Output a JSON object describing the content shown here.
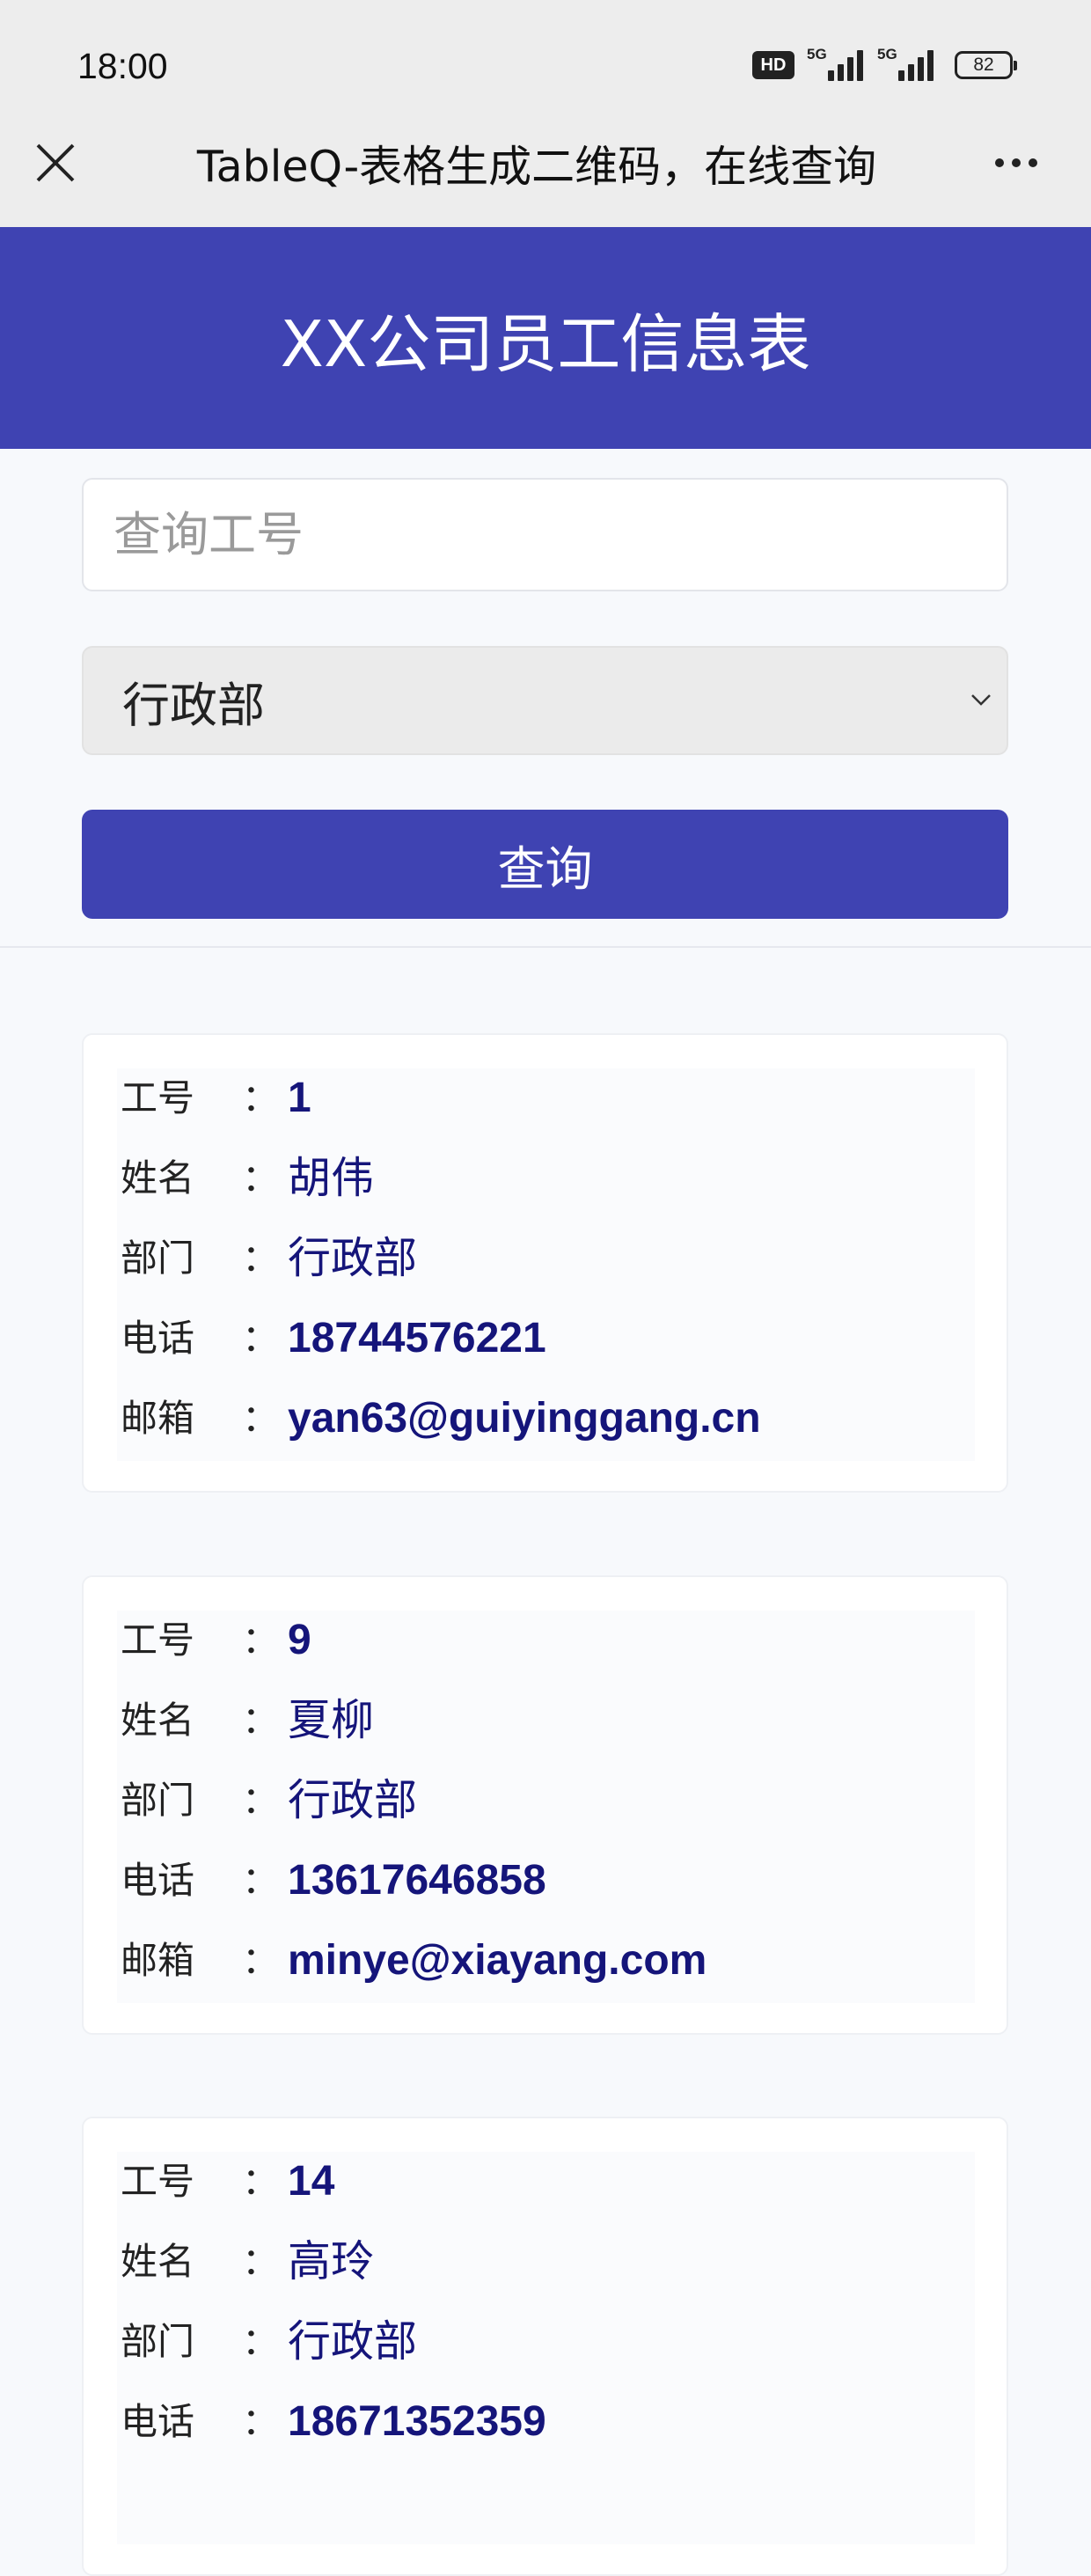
{
  "status_bar": {
    "time": "18:00",
    "hd_badge": "HD",
    "signal1_tag": "5G",
    "signal2_tag": "5G",
    "battery": "82"
  },
  "nav": {
    "title": "TableQ-表格生成二维码，在线查询",
    "close_icon": "close-icon",
    "more_icon": "more-dots-icon"
  },
  "header": {
    "title": "XX公司员工信息表"
  },
  "search": {
    "placeholder": "查询工号",
    "value": ""
  },
  "department_select": {
    "selected": "行政部"
  },
  "query_button": {
    "label": "查询"
  },
  "field_labels": {
    "id": "工号",
    "name": "姓名",
    "dept": "部门",
    "phone": "电话",
    "email": "邮箱",
    "separator": "："
  },
  "records": [
    {
      "id": "1",
      "name": "胡伟",
      "dept": "行政部",
      "phone": "18744576221",
      "email": "yan63@guiyinggang.cn"
    },
    {
      "id": "9",
      "name": "夏柳",
      "dept": "行政部",
      "phone": "13617646858",
      "email": "minye@xiayang.com"
    },
    {
      "id": "14",
      "name": "高玲",
      "dept": "行政部",
      "phone": "18671352359",
      "email": ""
    }
  ],
  "colors": {
    "primary": "#3f43b2",
    "value_text": "#15157a",
    "background": "#f7f9fc"
  }
}
